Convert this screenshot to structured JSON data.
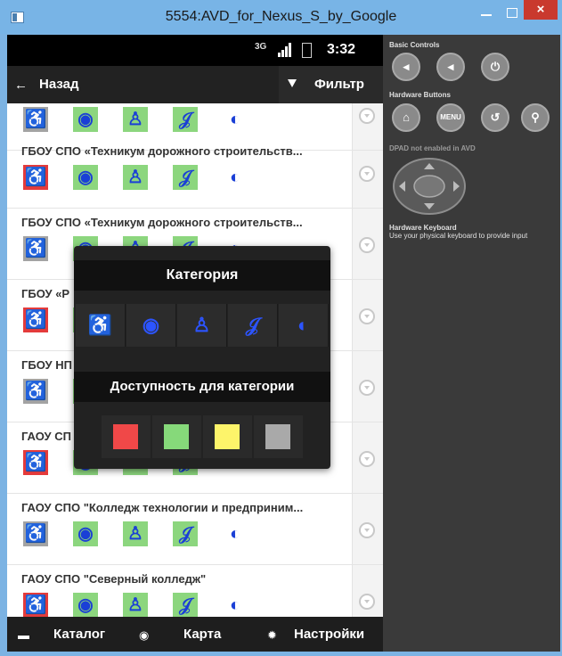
{
  "window": {
    "title": "5554:AVD_for_Nexus_S_by_Google",
    "close_glyph": "×"
  },
  "status_bar": {
    "network": "3G",
    "time": "3:32"
  },
  "action_bar": {
    "back_label": "Назад",
    "filter_label": "Фильтр"
  },
  "list": {
    "items": [
      {
        "title": "ГБОУ СПО «Техникум дорожного строительств...",
        "row_color": "#e43b3b"
      },
      {
        "title": "ГБОУ СПО «Техникум дорожного строительств...",
        "row_color": "#a3a3a3"
      },
      {
        "title": "ГБОУ «Р",
        "row_color": "#e43b3b"
      },
      {
        "title": "ГБОУ НП",
        "row_color": "#a3a3a3"
      },
      {
        "title": "ГАОУ СП",
        "row_color": "#e43b3b"
      },
      {
        "title": "ГАОУ СПО \"Колледж технологии и предприним...",
        "row_color": "#a3a3a3"
      },
      {
        "title": "ГАОУ СПО \"Северный колледж\"",
        "row_color": "#e43b3b"
      }
    ],
    "title_suffix": "."
  },
  "popup": {
    "category_title": "Категория",
    "accessibility_title": "Доступность для категории",
    "categories": [
      "wheelchair",
      "vision",
      "walking",
      "hearing",
      "mental"
    ],
    "swatches": [
      {
        "name": "red",
        "color": "#f04848"
      },
      {
        "name": "green",
        "color": "#86d97a"
      },
      {
        "name": "yellow",
        "color": "#fdf46a"
      },
      {
        "name": "gray",
        "color": "#a9a9a9"
      }
    ]
  },
  "bottom_bar": {
    "catalog_label": "Каталог",
    "map_label": "Карта",
    "settings_label": "Настройки"
  },
  "emulator_controls": {
    "basic_controls_label": "Basic Controls",
    "hardware_buttons_label": "Hardware Buttons",
    "menu_label": "MENU",
    "dpad_label": "DPAD not enabled in AVD",
    "keyboard_label": "Hardware Keyboard",
    "keyboard_hint": "Use your physical keyboard to provide input"
  },
  "icons": {
    "wheelchair": "♿",
    "vision": "◉",
    "walking": "♙",
    "hearing": "𝒥",
    "mental": "◐",
    "back": "←",
    "catalog": "▬",
    "map": "◉",
    "settings": "✹",
    "vol_down": "◂",
    "vol_up": "◂",
    "power": "⏻",
    "home": "⌂",
    "back_hw": "↺",
    "search_hw": "⚲"
  },
  "colors": {
    "accent_blue": "#1a3fd6",
    "green": "#8cd67e",
    "red": "#e43b3b",
    "gray": "#a3a3a3"
  }
}
